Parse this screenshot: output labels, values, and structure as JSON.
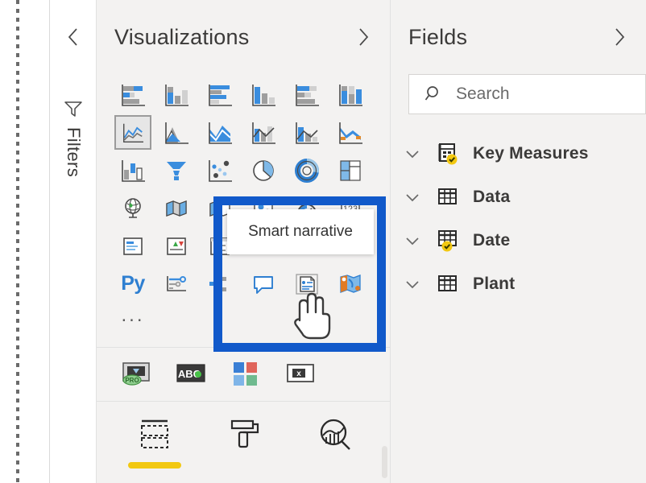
{
  "canvas": {
    "selection_edge": "dotted-vertical-line"
  },
  "filters_rail": {
    "collapse_icon": "chevron-left-icon",
    "filter_icon": "funnel-icon",
    "label": "Filters"
  },
  "visualizations": {
    "title": "Visualizations",
    "expand_icon": "chevron-right-icon",
    "more_label": "...",
    "python_label": "Py",
    "icons": [
      {
        "name": "stacked-bar-chart",
        "selected": false
      },
      {
        "name": "stacked-column-chart",
        "selected": false
      },
      {
        "name": "clustered-bar-chart",
        "selected": false
      },
      {
        "name": "clustered-column-chart",
        "selected": false
      },
      {
        "name": "hundred-percent-stacked-bar-chart",
        "selected": false
      },
      {
        "name": "hundred-percent-stacked-column-chart",
        "selected": false
      },
      {
        "name": "line-chart",
        "selected": true
      },
      {
        "name": "area-chart",
        "selected": false
      },
      {
        "name": "stacked-area-chart",
        "selected": false
      },
      {
        "name": "line-and-stacked-column-chart",
        "selected": false
      },
      {
        "name": "line-and-clustered-column-chart",
        "selected": false
      },
      {
        "name": "ribbon-chart",
        "selected": false
      },
      {
        "name": "waterfall-chart",
        "selected": false
      },
      {
        "name": "funnel-chart",
        "selected": false
      },
      {
        "name": "scatter-chart",
        "selected": false
      },
      {
        "name": "pie-chart",
        "selected": false
      },
      {
        "name": "donut-chart",
        "selected": false
      },
      {
        "name": "treemap-chart",
        "selected": false
      },
      {
        "name": "map-globe",
        "selected": false
      },
      {
        "name": "filled-map",
        "selected": false
      },
      {
        "name": "shape-map",
        "selected": false
      },
      {
        "name": "azure-map",
        "selected": false
      },
      {
        "name": "gauge-chart",
        "selected": false
      },
      {
        "name": "card-visual",
        "selected": false
      },
      {
        "name": "multi-row-card",
        "selected": false
      },
      {
        "name": "kpi-visual",
        "selected": false
      },
      {
        "name": "slicer-visual",
        "selected": false
      },
      {
        "name": "table-visual",
        "selected": false
      },
      {
        "name": "matrix-visual",
        "selected": false
      },
      {
        "name": "r-script-visual",
        "selected": false
      },
      {
        "name": "python-visual",
        "selected": false
      },
      {
        "name": "key-influencers",
        "selected": false
      },
      {
        "name": "decomposition-tree",
        "selected": false
      },
      {
        "name": "qna-visual",
        "selected": false
      },
      {
        "name": "smart-narrative",
        "selected": false
      },
      {
        "name": "arcgis-map",
        "selected": false
      }
    ],
    "custom_visuals": [
      {
        "name": "pro-custom-visual"
      },
      {
        "name": "abc-text-custom-visual"
      },
      {
        "name": "color-tiles-custom-visual"
      },
      {
        "name": "image-custom-visual"
      }
    ],
    "tabs": [
      {
        "name": "fields",
        "icon": "dashed-table-icon",
        "active": true
      },
      {
        "name": "format",
        "icon": "paint-roller-icon",
        "active": false
      },
      {
        "name": "analytics",
        "icon": "magnifier-chart-icon",
        "active": false
      }
    ]
  },
  "tooltip": {
    "text": "Smart narrative",
    "target": "smart-narrative"
  },
  "highlight": {
    "color": "#1159ca",
    "annotates": "smart-narrative-icon"
  },
  "fields": {
    "title": "Fields",
    "expand_icon": "chevron-right-icon",
    "search": {
      "placeholder": "Search",
      "value": "",
      "icon": "search-icon"
    },
    "tables": [
      {
        "label": "Key Measures",
        "icon": "measure-table-icon",
        "badge": true,
        "expanded": false
      },
      {
        "label": "Data",
        "icon": "table-icon",
        "badge": false,
        "expanded": false
      },
      {
        "label": "Date",
        "icon": "table-icon",
        "badge": true,
        "expanded": false
      },
      {
        "label": "Plant",
        "icon": "table-icon",
        "badge": false,
        "expanded": false
      }
    ]
  },
  "cursor": {
    "type": "pointing-hand-cursor"
  }
}
